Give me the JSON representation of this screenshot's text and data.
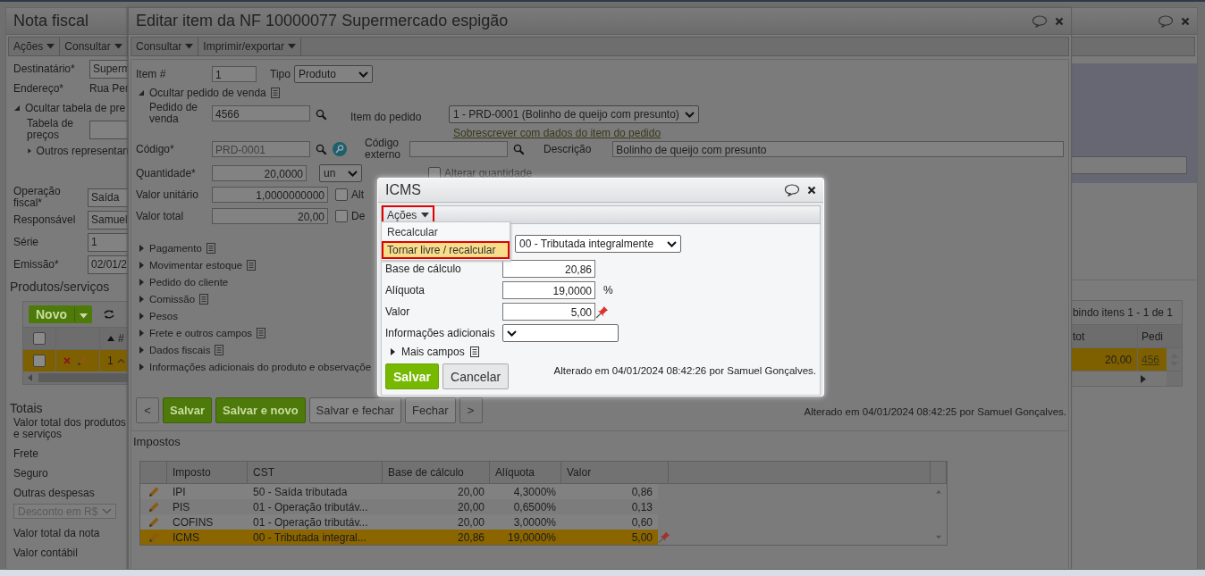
{
  "main_window": {
    "title": "Nota fiscal",
    "menus": [
      {
        "label": "Ações"
      },
      {
        "label": "Consultar"
      }
    ],
    "customer_fields": [
      {
        "kind": "input",
        "label": "Destinatário*",
        "value": "Superm"
      },
      {
        "kind": "static",
        "label": "Endereço*",
        "value": "Rua Per"
      },
      {
        "kind": "toggle",
        "label": "Ocultar tabela de pre",
        "expanded": true
      },
      {
        "kind": "input",
        "label": "Tabela de preços",
        "indent": true
      },
      {
        "kind": "toggle",
        "label": "Outros representan",
        "expanded": false,
        "indent": true
      }
    ],
    "invoice_fields": [
      {
        "label": "Operação fiscal*",
        "value": "Saída"
      },
      {
        "label": "Responsável",
        "value": "Samuel"
      },
      {
        "label": "Série",
        "value": "1"
      },
      {
        "label": "Emissão*",
        "value": "02/01/2"
      }
    ],
    "products": {
      "title": "Produtos/serviços",
      "new_button": "Novo",
      "all_checked": false,
      "pager": "bindo itens 1 - 1 de 1",
      "columns": [
        {
          "label": "#",
          "sorted": true
        },
        {
          "label": "tot"
        },
        {
          "label": "Pedi"
        }
      ],
      "rows": [
        {
          "selected": true,
          "checked": false,
          "cells": [
            "1",
            "20,00",
            "456"
          ]
        }
      ]
    },
    "totals": {
      "title": "Totais",
      "items": [
        {
          "kind": "label",
          "text": "Valor total dos produtos e serviços"
        },
        {
          "kind": "label",
          "text": "Frete"
        },
        {
          "kind": "label",
          "text": "Seguro"
        },
        {
          "kind": "label",
          "text": "Outras despesas"
        },
        {
          "kind": "select",
          "text": "Desconto em R$"
        },
        {
          "kind": "label",
          "text": "Valor total da nota"
        },
        {
          "kind": "label",
          "text": "Valor contábil"
        }
      ]
    }
  },
  "edit_window": {
    "title": "Editar item da NF 10000077 Supermercado espigão",
    "menus": [
      {
        "label": "Consultar"
      },
      {
        "label": "Imprimir/exportar"
      }
    ],
    "item_number": {
      "label": "Item #",
      "value": "1"
    },
    "type": {
      "label": "Tipo",
      "value": "Produto"
    },
    "order_toggle": {
      "label": "Ocultar pedido de venda",
      "expanded": true
    },
    "sales_order": {
      "label": "Pedido de venda",
      "value": "4566"
    },
    "order_item": {
      "label": "Item do pedido",
      "value": "1 - PRD-0001 (Bolinho de queijo com presunto)"
    },
    "overwrite_link": "Sobrescrever com dados do item do pedido",
    "code": {
      "label": "Código*",
      "value": "PRD-0001"
    },
    "external_code": {
      "label": "Código externo"
    },
    "description": {
      "label": "Descrição",
      "value": "Bolinho de queijo com presunto"
    },
    "quantity": {
      "label": "Quantidade*",
      "value": "20,0000",
      "unit": "un"
    },
    "change_quantity": {
      "label": "Alterar quantidade",
      "checked": false,
      "disabled": true
    },
    "unit_value": {
      "label": "Valor unitário",
      "value": "1,0000000000",
      "check_label": "Alt",
      "checked": false
    },
    "total_value": {
      "label": "Valor total",
      "value": "20,00",
      "check_label": "De",
      "checked": false
    },
    "sections": [
      {
        "label": "Pagamento",
        "notes": true
      },
      {
        "label": "Movimentar estoque",
        "notes": true
      },
      {
        "label": "Pedido do cliente",
        "notes": false
      },
      {
        "label": "Comissão",
        "notes": true
      },
      {
        "label": "Pesos",
        "notes": false
      },
      {
        "label": "Frete e outros campos",
        "notes": true
      },
      {
        "label": "Dados fiscais",
        "notes": true
      },
      {
        "label": "Informações adicionais do produto e observaçõe",
        "notes": false
      }
    ],
    "buttons": [
      {
        "kind": "nav",
        "label": "<"
      },
      {
        "kind": "primary",
        "label": "Salvar"
      },
      {
        "kind": "primary",
        "label": "Salvar e novo"
      },
      {
        "kind": "secondary",
        "label": "Salvar e fechar"
      },
      {
        "kind": "secondary",
        "label": "Fechar"
      },
      {
        "kind": "nav",
        "label": ">"
      }
    ],
    "audit": "Alterado em 04/01/2024 08:42:25 por Samuel Gonçalves.",
    "taxes": {
      "title": "Impostos",
      "columns": [
        "Imposto",
        "CST",
        "Base de cálculo",
        "Alíquota",
        "Valor"
      ],
      "rows": [
        {
          "selected": false,
          "pinned": false,
          "cells": [
            "IPI",
            "50 - Saída tributada",
            "20,00",
            "4,3000%",
            "0,86"
          ]
        },
        {
          "selected": false,
          "pinned": false,
          "cells": [
            "PIS",
            "01 - Operação tributáv...",
            "20,00",
            "0,6500%",
            "0,13"
          ]
        },
        {
          "selected": false,
          "pinned": false,
          "cells": [
            "COFINS",
            "01 - Operação tributáv...",
            "20,00",
            "3,0000%",
            "0,60"
          ]
        },
        {
          "selected": true,
          "pinned": true,
          "cells": [
            "ICMS",
            "00 - Tributada integral...",
            "20,86",
            "19,0000%",
            "5,00"
          ]
        }
      ]
    }
  },
  "icms_dialog": {
    "title": "ICMS",
    "menu": {
      "label": "Ações",
      "callout": true
    },
    "menu_items": [
      {
        "label": "Recalcular",
        "highlighted": false,
        "callout": false
      },
      {
        "label": "Tornar livre / recalcular",
        "highlighted": true,
        "callout": true
      }
    ],
    "cst": "00 - Tributada integralmente",
    "fields": [
      {
        "label": "Base de cálculo",
        "value": "20,86",
        "pinned": false
      },
      {
        "label": "Alíquota",
        "value": "19,0000",
        "unit": "%",
        "pinned": false
      },
      {
        "label": "Valor",
        "value": "5,00",
        "pinned": true
      }
    ],
    "additional_info": {
      "label": "Informações adicionais"
    },
    "more_fields": {
      "label": "Mais campos",
      "expanded": false
    },
    "buttons": [
      {
        "kind": "primary",
        "label": "Salvar"
      },
      {
        "kind": "secondary",
        "label": "Cancelar"
      }
    ],
    "audit": "Alterado em 04/01/2024 08:42:26 por Samuel Gonçalves."
  }
}
